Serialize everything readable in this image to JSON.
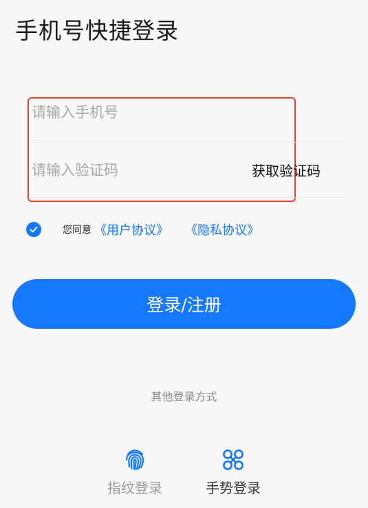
{
  "page": {
    "title": "手机号快捷登录"
  },
  "form": {
    "phone_placeholder": "请输入手机号",
    "code_placeholder": "请输入验证码",
    "get_code_label": "获取验证码"
  },
  "agreement": {
    "checked": true,
    "prefix": "您同意",
    "user_agreement": "《用户协议》",
    "privacy_agreement": "《隐私协议》"
  },
  "login_button": {
    "label": "登录/注册"
  },
  "other_login": {
    "label": "其他登录方式",
    "methods": [
      {
        "icon": "fingerprint-icon",
        "label": "指纹登录"
      },
      {
        "icon": "gesture-icon",
        "label": "手势登录"
      }
    ]
  },
  "colors": {
    "accent": "#1677ff",
    "highlight_border": "#e4402f",
    "background": "#f8f8f8"
  }
}
